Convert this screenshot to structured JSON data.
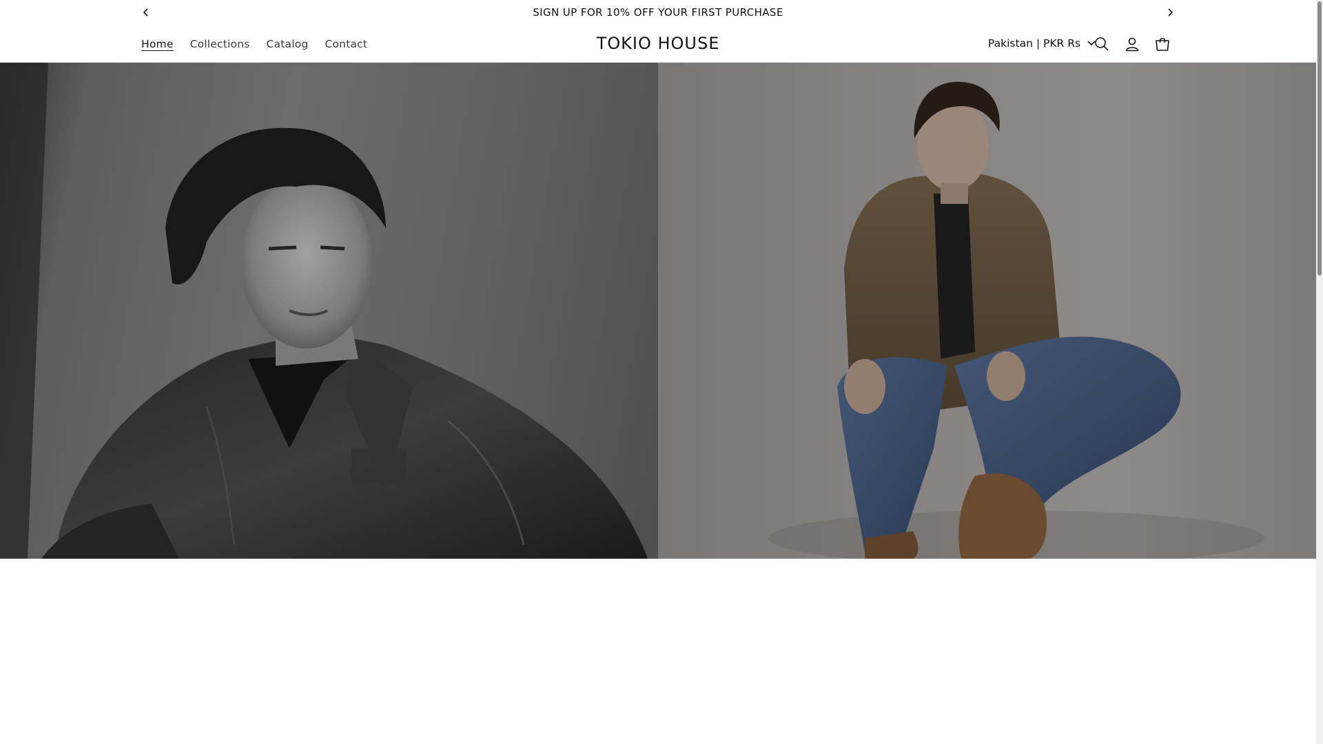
{
  "announcement": {
    "text": "SIGN UP FOR 10% OFF YOUR FIRST PURCHASE"
  },
  "header": {
    "nav": [
      {
        "label": "Home",
        "active": true
      },
      {
        "label": "Collections",
        "active": false
      },
      {
        "label": "Catalog",
        "active": false
      },
      {
        "label": "Contact",
        "active": false
      }
    ],
    "logo": "TOKIO HOUSE",
    "country_selector": "Pakistan | PKR Rs",
    "icons": [
      "search-icon",
      "account-icon",
      "cart-icon"
    ]
  },
  "hero": {
    "left_image": "model-black-denim-jacket-photo",
    "right_image": "model-brown-jacket-jeans-photo"
  },
  "colors": {
    "text": "#121212",
    "background": "#ffffff"
  }
}
